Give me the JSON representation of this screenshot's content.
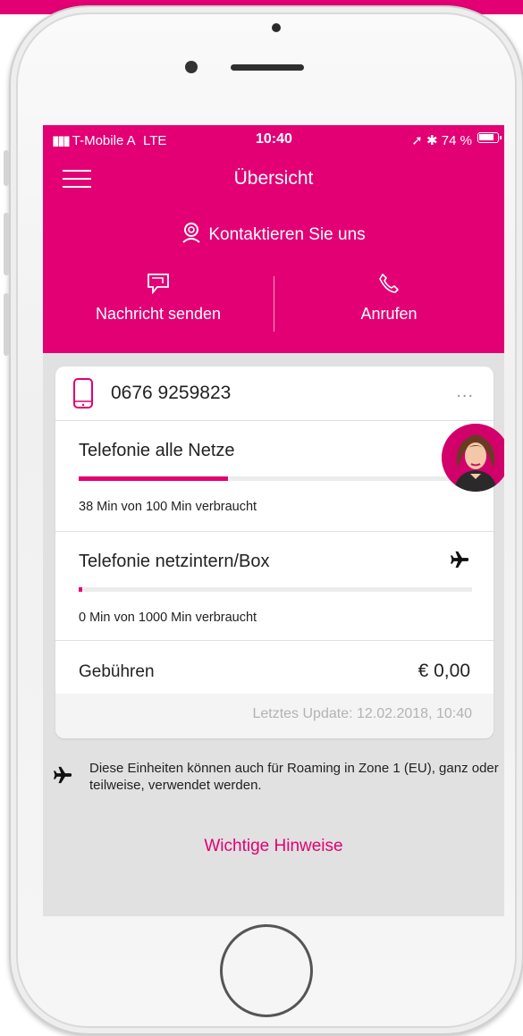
{
  "status_bar": {
    "carrier": "T-Mobile A",
    "network": "LTE",
    "time": "10:40",
    "battery": "74 %"
  },
  "header": {
    "title": "Übersicht"
  },
  "contact": {
    "label": "Kontaktieren Sie uns",
    "message_label": "Nachricht senden",
    "call_label": "Anrufen"
  },
  "card": {
    "number": "0676 9259823",
    "more_label": "...",
    "sections": [
      {
        "title": "Telefonie alle Netze",
        "usage": "38 Min von 100 Min verbraucht",
        "used_fraction": 0.38
      },
      {
        "title": "Telefonie netzintern/Box",
        "usage": "0 Min von 1000 Min verbraucht",
        "used_fraction": 0.0
      }
    ],
    "fees_label": "Gebühren",
    "fees_value": "€ 0,00",
    "last_update": "Letztes Update: 12.02.2018, 10:40"
  },
  "roaming_note": "Diese Einheiten können auch für Roaming in Zone 1 (EU), ganz oder teilweise, verwendet werden.",
  "important_link": "Wichtige Hinweise",
  "colors": {
    "brand": "#e20074",
    "background": "#e1e1e1"
  },
  "icons": [
    "menu-icon",
    "contact-icon",
    "message-icon",
    "phone-call-icon",
    "mobile-phone-icon",
    "airplane-icon",
    "avatar"
  ]
}
